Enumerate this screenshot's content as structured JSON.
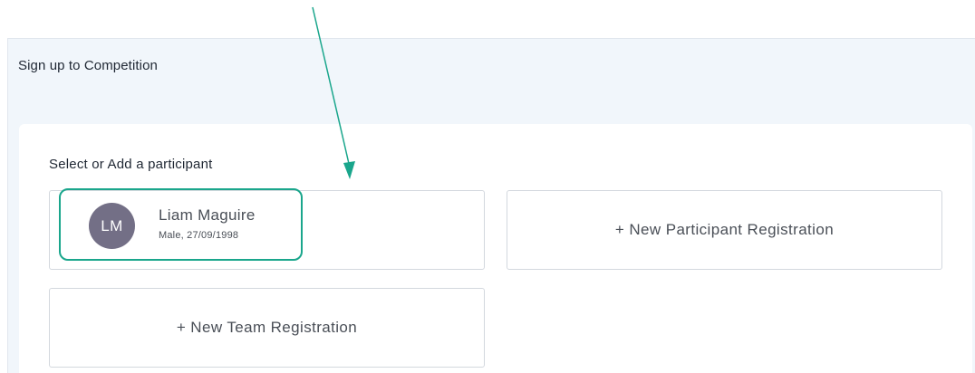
{
  "panel": {
    "title": "Sign up to Competition"
  },
  "selection": {
    "heading": "Select or Add a participant",
    "participant": {
      "initials": "LM",
      "name": "Liam Maguire",
      "details": "Male, 27/09/1998"
    },
    "new_participant_label": "+ New Participant Registration",
    "new_team_label": "+ New Team Registration"
  },
  "colors": {
    "annotation": "#1aa68c",
    "avatar": "#736f86",
    "panel_bg": "#f1f6fb"
  }
}
